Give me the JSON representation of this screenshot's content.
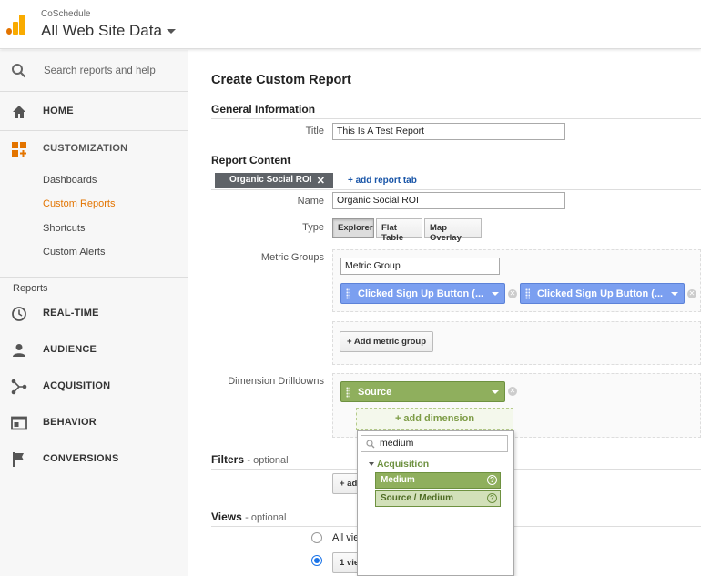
{
  "header": {
    "account": "CoSchedule",
    "property": "All Web Site Data"
  },
  "sidebar": {
    "search_label": "Search reports and help",
    "home": "HOME",
    "customization": "CUSTOMIZATION",
    "sub_items": [
      "Dashboards",
      "Custom Reports",
      "Shortcuts",
      "Custom Alerts"
    ],
    "reports_label": "Reports",
    "reports": [
      "REAL-TIME",
      "AUDIENCE",
      "ACQUISITION",
      "BEHAVIOR",
      "CONVERSIONS"
    ]
  },
  "main": {
    "page_title": "Create Custom Report",
    "general_info": "General Information",
    "title_label": "Title",
    "title_value": "This Is A Test Report",
    "report_content": "Report Content",
    "tab_name": "Organic Social ROI",
    "add_tab": "+ add report tab",
    "name_label": "Name",
    "name_value": "Organic Social ROI",
    "type_label": "Type",
    "types": [
      "Explorer",
      "Flat Table",
      "Map Overlay"
    ],
    "metric_groups_label": "Metric Groups",
    "metric_group_value": "Metric Group",
    "metric_1": "Clicked Sign Up Button (...",
    "metric_2": "Clicked Sign Up Button (...",
    "add_metric_group": "+ Add metric group",
    "dimension_label": "Dimension Drilldowns",
    "dimension_1": "Source",
    "add_dimension": "+ add dimension",
    "filters": "Filters",
    "filters_opt": "- optional",
    "filters_btn": "+ ad",
    "views": "Views",
    "views_opt": "- optional",
    "view_all": "All vie",
    "view_one": "1 vie"
  },
  "dropdown": {
    "search_value": "medium",
    "category": "Acquisition",
    "options": [
      "Medium",
      "Source / Medium"
    ],
    "help": "?"
  },
  "colors": {
    "accent_orange": "#e37400",
    "metric_blue": "#7b9ff0",
    "dimension_green": "#8faf5d",
    "link_blue": "#1a56a8"
  }
}
